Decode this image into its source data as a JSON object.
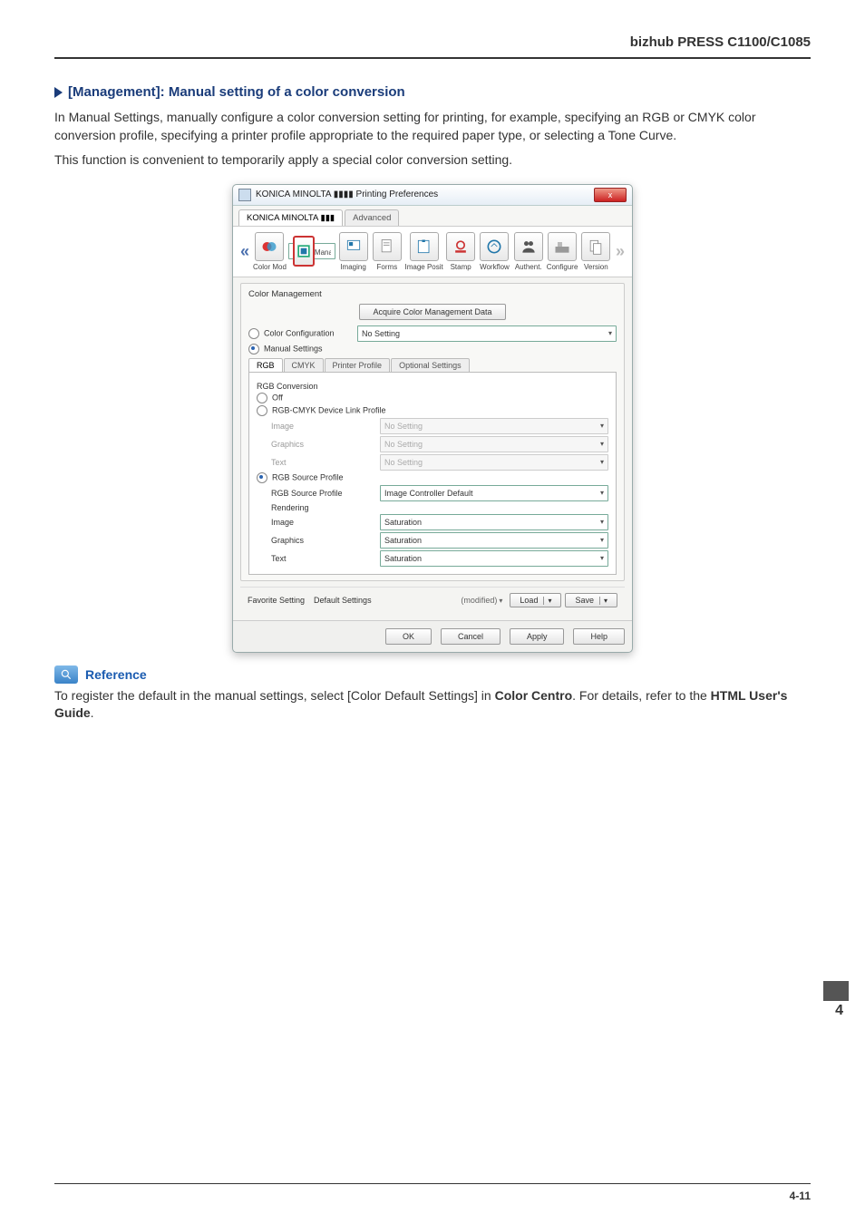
{
  "header": {
    "product": "bizhub PRESS C1100/C1085"
  },
  "section": {
    "title": "[Management]: Manual setting of a color conversion",
    "p1": "In Manual Settings, manually configure a color conversion setting for printing, for example, specifying an RGB or CMYK color conversion profile, specifying a printer profile appropriate to the required paper type, or selecting a Tone Curve.",
    "p2": "This function is convenient to temporarily apply a special color conversion setting."
  },
  "dialog": {
    "title": "KONICA MINOLTA ▮▮▮▮ Printing Preferences",
    "close": "x",
    "main_tabs": {
      "t0": "KONICA MINOLTA ▮▮▮",
      "t1": "Advanced"
    },
    "iconbar": {
      "left": "«",
      "right": "»",
      "items": [
        {
          "label": "Color Mod"
        },
        {
          "label": "Managemen"
        },
        {
          "label": "Imaging"
        },
        {
          "label": "Forms"
        },
        {
          "label": "Image Position"
        },
        {
          "label": "Stamp"
        },
        {
          "label": "Workflow"
        },
        {
          "label": "Authent."
        },
        {
          "label": "Configure"
        },
        {
          "label": "Version"
        }
      ]
    },
    "group_title": "Color Management",
    "acquire_btn": "Acquire Color Management Data",
    "color_config": {
      "label": "Color Configuration",
      "value": "No Setting"
    },
    "manual_settings_label": "Manual Settings",
    "sub_tabs": {
      "t0": "RGB",
      "t1": "CMYK",
      "t2": "Printer Profile",
      "t3": "Optional Settings"
    },
    "rgb": {
      "section1": "RGB Conversion",
      "off": "Off",
      "devlink": "RGB-CMYK Device Link Profile",
      "image": "Image",
      "image_v": "No Setting",
      "graphics": "Graphics",
      "graphics_v": "No Setting",
      "text": "Text",
      "text_v": "No Setting",
      "srcprof": "RGB Source Profile",
      "srcprof_lbl": "RGB Source Profile",
      "srcprof_v": "Image Controller Default",
      "rendering": "Rendering",
      "r_image": "Image",
      "r_image_v": "Saturation",
      "r_graphics": "Graphics",
      "r_graphics_v": "Saturation",
      "r_text": "Text",
      "r_text_v": "Saturation"
    },
    "fav": {
      "label": "Favorite Setting",
      "value": "Default Settings",
      "modified": "(modified)",
      "load": "Load",
      "save": "Save"
    },
    "btns": {
      "ok": "OK",
      "cancel": "Cancel",
      "apply": "Apply",
      "help": "Help"
    }
  },
  "reference": {
    "title": "Reference",
    "body_pre": "To register the default in the manual settings, select [Color Default Settings] in ",
    "bold1": "Color Centro",
    "mid": ". For details, refer to the ",
    "bold2": "HTML User's Guide",
    "post": "."
  },
  "page_side": "4",
  "page_num": "4-11"
}
